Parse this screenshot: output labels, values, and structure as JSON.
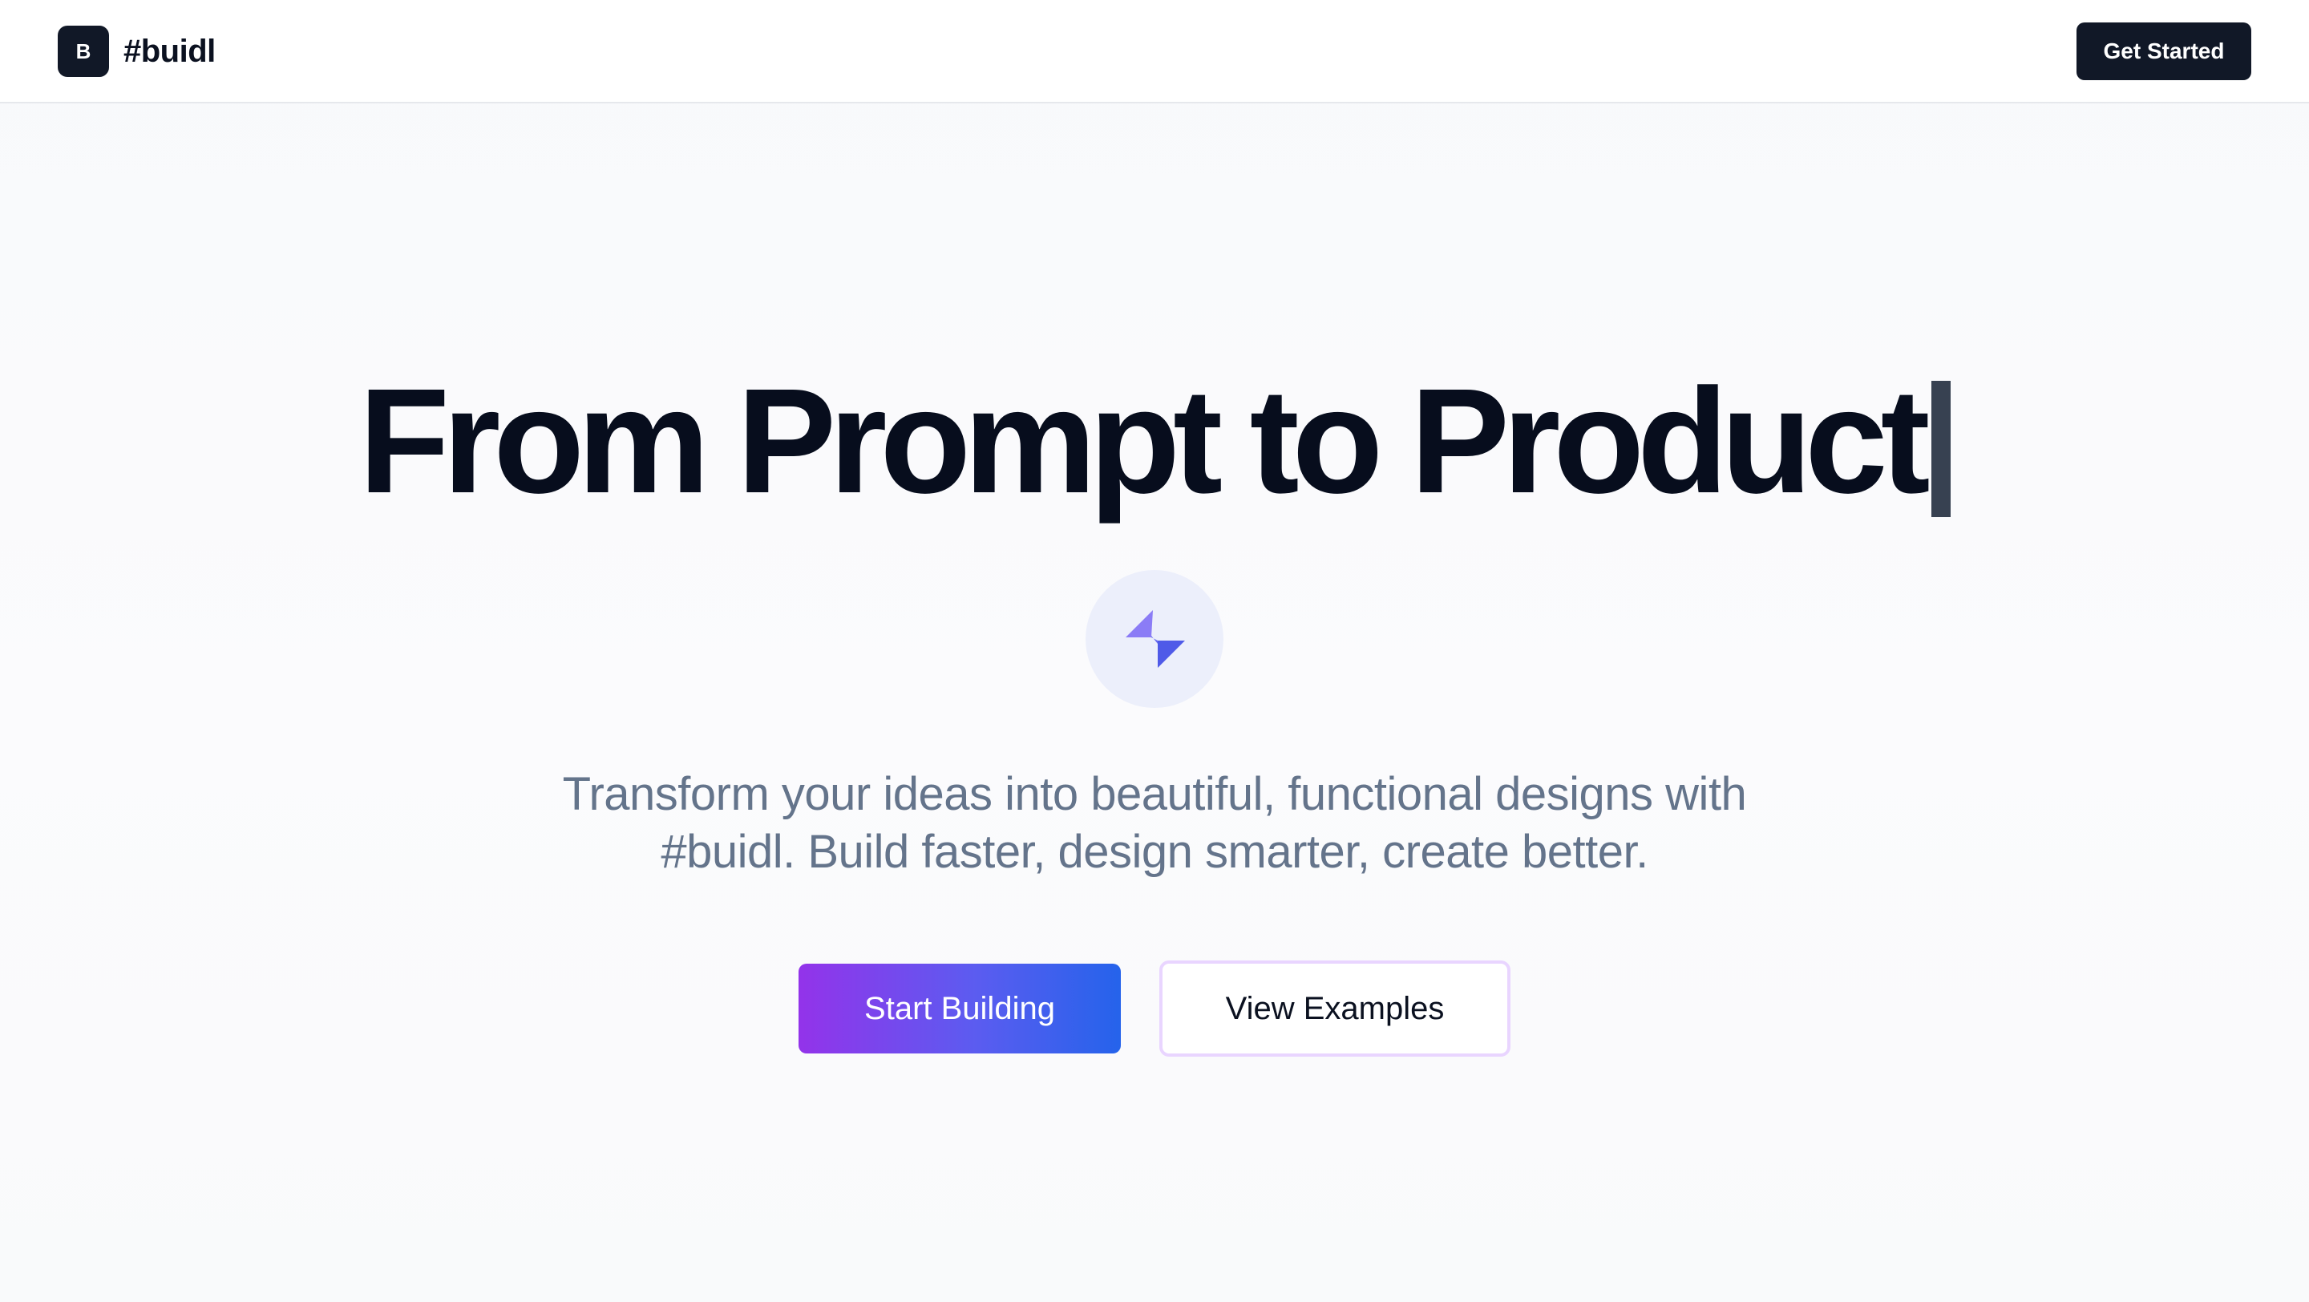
{
  "header": {
    "logo_letter": "B",
    "brand_name": "#buidl",
    "cta_label": "Get Started"
  },
  "hero": {
    "title": "From Prompt to Product",
    "icon": "lightning-bolt-icon",
    "subtitle_line1": "Transform your ideas into beautiful, functional designs with",
    "subtitle_line2": "#buidl. Build faster, design smarter, create better.",
    "primary_button": "Start Building",
    "secondary_button": "View Examples"
  },
  "colors": {
    "dark": "#111827",
    "title": "#070d1d",
    "subtitle": "#64748b",
    "gradient_start": "#9333ea",
    "gradient_end": "#2563eb",
    "secondary_border": "#e9d5ff",
    "bolt_light": "#8b7cf6",
    "bolt_dark": "#4f5ae8"
  }
}
